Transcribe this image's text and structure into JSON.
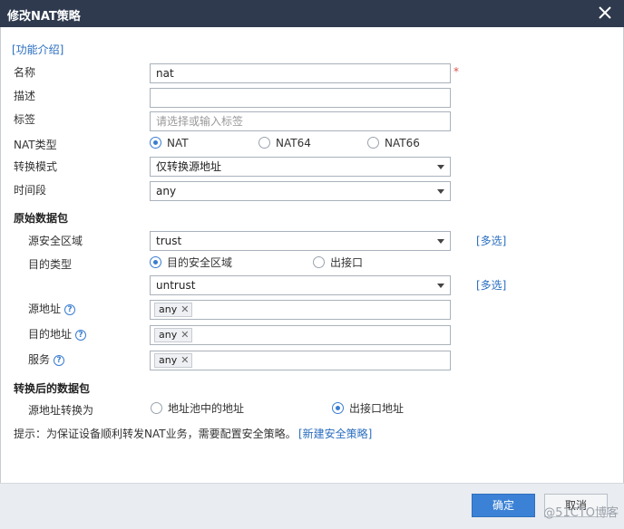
{
  "dialog": {
    "title": "修改NAT策略"
  },
  "intro_link": "[功能介绍]",
  "fields": {
    "name": {
      "label": "名称",
      "value": "nat",
      "required_mark": "*"
    },
    "description": {
      "label": "描述",
      "value": ""
    },
    "tags": {
      "label": "标签",
      "placeholder": "请选择或输入标签"
    },
    "nat_type": {
      "label": "NAT类型",
      "options": [
        "NAT",
        "NAT64",
        "NAT66"
      ],
      "selected": "NAT"
    },
    "convert_mode": {
      "label": "转换模式",
      "value": "仅转换源地址"
    },
    "time_range": {
      "label": "时间段",
      "value": "any"
    }
  },
  "original_packet": {
    "heading": "原始数据包",
    "source_zone": {
      "label": "源安全区域",
      "value": "trust",
      "multi_link": "[多选]"
    },
    "dest_type": {
      "label": "目的类型",
      "options": [
        "目的安全区域",
        "出接口"
      ],
      "selected": "目的安全区域"
    },
    "dest_zone": {
      "value": "untrust",
      "multi_link": "[多选]"
    },
    "source_address": {
      "label": "源地址",
      "tag": "any"
    },
    "dest_address": {
      "label": "目的地址",
      "tag": "any"
    },
    "service": {
      "label": "服务",
      "tag": "any"
    }
  },
  "translated_packet": {
    "heading": "转换后的数据包",
    "source_translate": {
      "label": "源地址转换为",
      "options": [
        "地址池中的地址",
        "出接口地址"
      ],
      "selected": "出接口地址"
    }
  },
  "hint": {
    "text": "提示：为保证设备顺利转发NAT业务，需要配置安全策略。",
    "link": "[新建安全策略]"
  },
  "buttons": {
    "ok": "确定",
    "cancel": "取消"
  },
  "watermark": "@51CTO博客",
  "colors": {
    "titlebar": "#2f3a4e",
    "accent": "#3b82d6",
    "link": "#2a6ebf",
    "required": "#d9534f"
  }
}
